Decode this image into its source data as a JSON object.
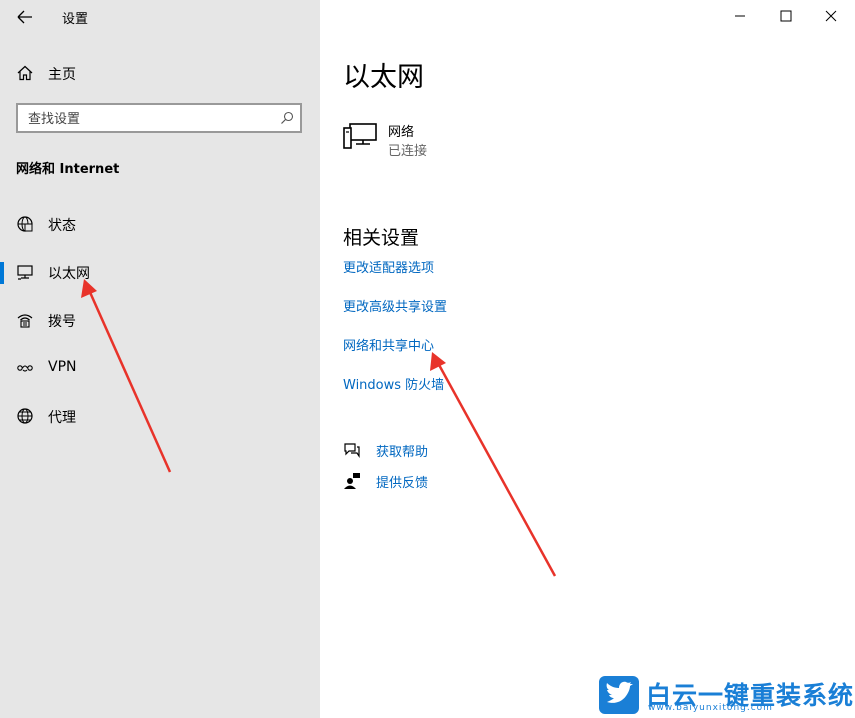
{
  "window": {
    "app_title": "设置"
  },
  "sidebar": {
    "home_label": "主页",
    "search": {
      "placeholder": "查找设置"
    },
    "section_title": "网络和 Internet",
    "items": [
      {
        "label": "状态",
        "icon": "globe-status-icon",
        "selected": false
      },
      {
        "label": "以太网",
        "icon": "ethernet-icon",
        "selected": true
      },
      {
        "label": "拨号",
        "icon": "dialup-icon",
        "selected": false
      },
      {
        "label": "VPN",
        "icon": "vpn-icon",
        "selected": false
      },
      {
        "label": "代理",
        "icon": "globe-proxy-icon",
        "selected": false
      }
    ]
  },
  "main": {
    "page_title": "以太网",
    "network": {
      "name": "网络",
      "status": "已连接",
      "icon": "ethernet-computer-icon"
    },
    "related_title": "相关设置",
    "links": [
      {
        "label": "更改适配器选项"
      },
      {
        "label": "更改高级共享设置"
      },
      {
        "label": "网络和共享中心"
      },
      {
        "label": "Windows 防火墙"
      }
    ],
    "help": [
      {
        "label": "获取帮助",
        "icon": "chat-help-icon"
      },
      {
        "label": "提供反馈",
        "icon": "feedback-icon"
      }
    ]
  },
  "watermark": {
    "text": "白云一键重装系统",
    "url": "www.baiyunxitong.com",
    "logo": "twitter-bird-icon"
  },
  "colors": {
    "accent": "#0078d7",
    "link": "#0067c0",
    "sidebar_bg": "#e6e6e6",
    "arrow": "#e8332a",
    "watermark": "#1a7fd6"
  }
}
